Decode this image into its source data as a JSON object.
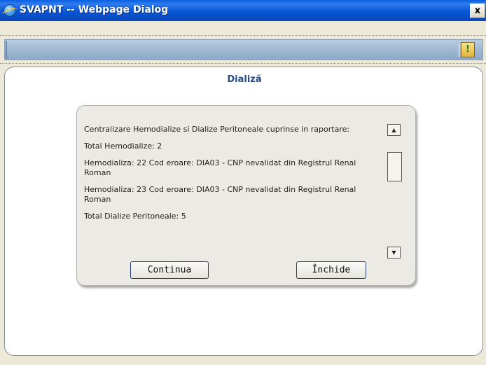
{
  "window": {
    "title": "SVAPNT -- Webpage Dialog",
    "close_label": "x"
  },
  "toolbar": {
    "help_label": "!"
  },
  "panel": {
    "title": "Dializă"
  },
  "message": {
    "lines": [
      "Centralizare Hemodialize si Dialize Peritoneale cuprinse in raportare:",
      "Total Hemodialize: 2",
      "Hemodializa: 22 Cod eroare: DIA03 - CNP nevalidat din Registrul Renal Roman",
      "Hemodializa: 23 Cod eroare: DIA03 - CNP nevalidat din Registrul Renal Roman",
      "Total Dialize Peritoneale: 5"
    ]
  },
  "scrollbar": {
    "up_glyph": "▲",
    "down_glyph": "▼"
  },
  "buttons": {
    "continue_label": "Continua",
    "close_label": "Închide"
  },
  "colors": {
    "title_bar": "#0a56d6",
    "panel_title": "#2a4a86",
    "toolbar": "#9fb8d2"
  }
}
